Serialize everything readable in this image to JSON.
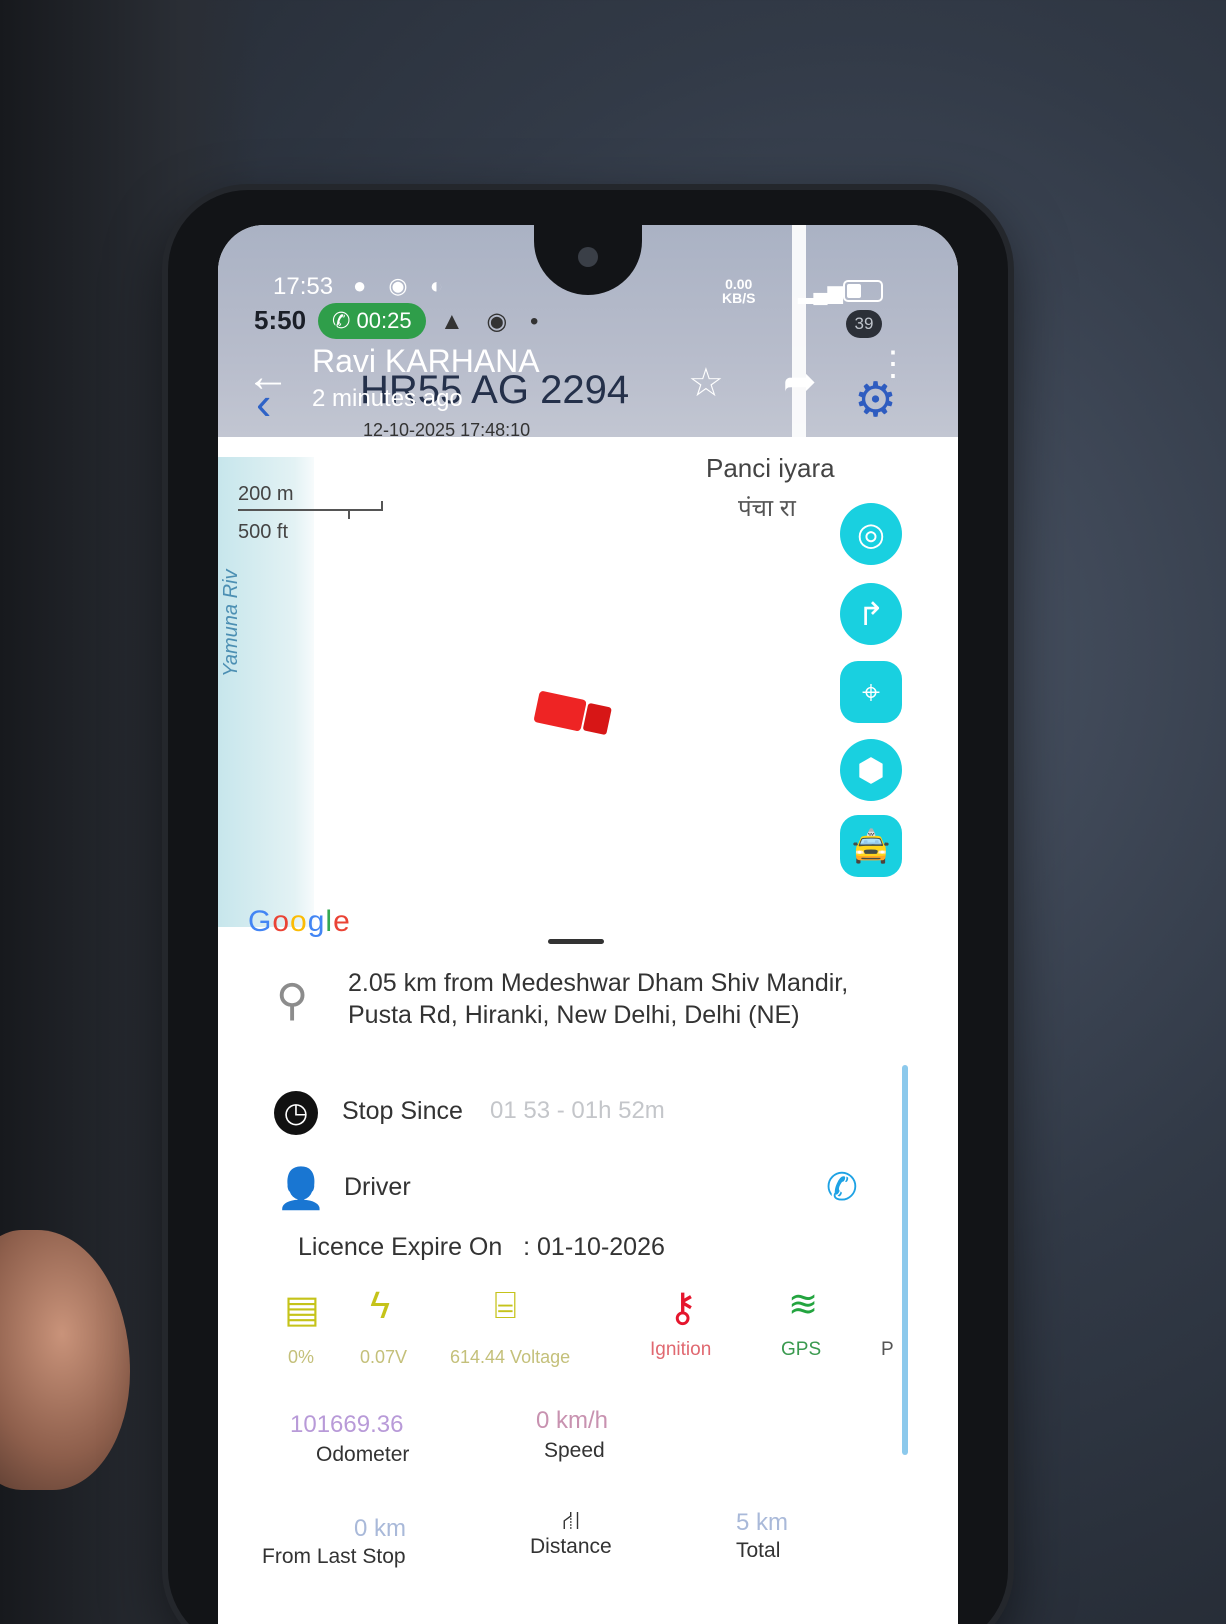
{
  "status_bar": {
    "time_top": "17:53",
    "time_bottom": "5:50",
    "call_duration": "00:25",
    "net_speed": "0.00",
    "net_unit": "KB/S",
    "battery_badge": "39"
  },
  "header": {
    "driver_name": "Ravi KARHANA",
    "last_update": "2 minutes ago",
    "vehicle_number": "HR55 AG 2294",
    "timestamp": "12-10-2025 17:48:10"
  },
  "map": {
    "scale_metric": "200 m",
    "scale_imperial": "500 ft",
    "river_label": "Yamuna Riv",
    "place_name_en": "Panci  iyara",
    "place_name_hi": "पंचा  रा",
    "attribution": "Google"
  },
  "details": {
    "address": "2.05 km from Medeshwar Dham Shiv Mandir, Pusta Rd, Hiranki, New Delhi, Delhi (NE)",
    "stop_label": "Stop Since",
    "stop_value": "01 53 - 01h 52m",
    "driver_label": "Driver",
    "licence_label": "Licence Expire On",
    "licence_value": ": 01-10-2026"
  },
  "sensors": {
    "battery_label": "0%",
    "volt_label": "0.07V",
    "voltage_label": "614.44 Voltage",
    "ignition_label": "Ignition",
    "gps_label": "GPS",
    "extra_label": "P"
  },
  "stats": {
    "odometer_value": "101669.36",
    "odometer_label": "Odometer",
    "speed_value": "0 km/h",
    "speed_label": "Speed",
    "last_stop_value": "0 km",
    "last_stop_label": "From Last Stop",
    "distance_label": "Distance",
    "total_value": "5 km",
    "total_label": "Total"
  },
  "colors": {
    "fab_cyan": "#19d0e0",
    "ignition_red": "#e5162d",
    "gps_green": "#23a43f",
    "phone_blue": "#1ea2e4"
  }
}
